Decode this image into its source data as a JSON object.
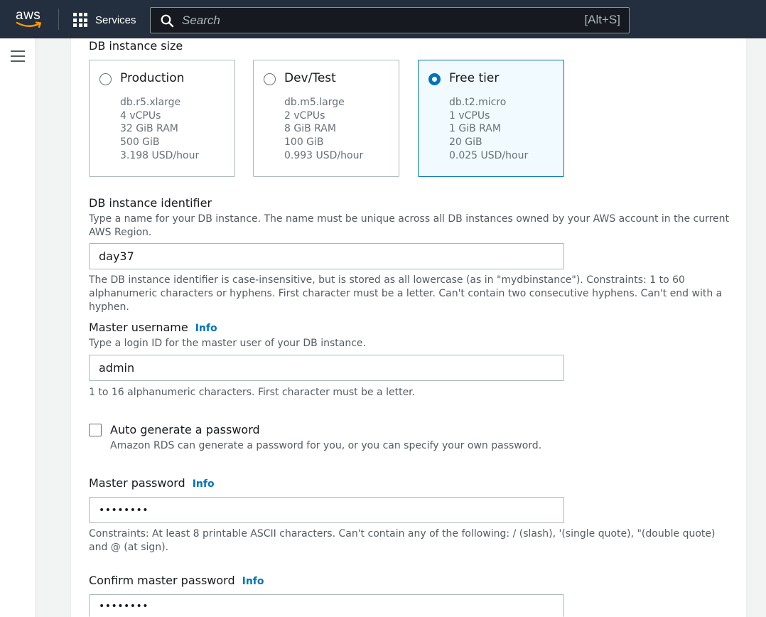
{
  "nav": {
    "logo_text": "aws",
    "services_label": "Services",
    "search_placeholder": "Search",
    "search_shortcut": "[Alt+S]"
  },
  "instance_size": {
    "heading": "DB instance size",
    "options": [
      {
        "title": "Production",
        "specs": [
          "db.r5.xlarge",
          "4 vCPUs",
          "32 GiB RAM",
          "500 GiB",
          "3.198 USD/hour"
        ],
        "selected": false
      },
      {
        "title": "Dev/Test",
        "specs": [
          "db.m5.large",
          "2 vCPUs",
          "8 GiB RAM",
          "100 GiB",
          "0.993 USD/hour"
        ],
        "selected": false
      },
      {
        "title": "Free tier",
        "specs": [
          "db.t2.micro",
          "1 vCPUs",
          "1 GiB RAM",
          "20 GiB",
          "0.025 USD/hour"
        ],
        "selected": true
      }
    ]
  },
  "identifier": {
    "label": "DB instance identifier",
    "description": "Type a name for your DB instance. The name must be unique across all DB instances owned by your AWS account in the current AWS Region.",
    "value": "day37",
    "constraint": "The DB instance identifier is case-insensitive, but is stored as all lowercase (as in \"mydbinstance\"). Constraints: 1 to 60 alphanumeric characters or hyphens. First character must be a letter. Can't contain two consecutive hyphens. Can't end with a hyphen."
  },
  "username": {
    "label": "Master username",
    "info": "Info",
    "description": "Type a login ID for the master user of your DB instance.",
    "value": "admin",
    "constraint": "1 to 16 alphanumeric characters. First character must be a letter."
  },
  "auto_password": {
    "label": "Auto generate a password",
    "description": "Amazon RDS can generate a password for you, or you can specify your own password.",
    "checked": false
  },
  "password": {
    "label": "Master password",
    "info": "Info",
    "masked_value": "••••••••",
    "constraint": "Constraints: At least 8 printable ASCII characters. Can't contain any of the following: / (slash), '(single quote), \"(double quote) and @ (at sign)."
  },
  "confirm_password": {
    "label": "Confirm master password",
    "info": "Info",
    "masked_value": "••••••••"
  },
  "colors": {
    "nav_bg": "#232f3e",
    "accent": "#0073bb",
    "logo_smile": "#ff9900"
  }
}
